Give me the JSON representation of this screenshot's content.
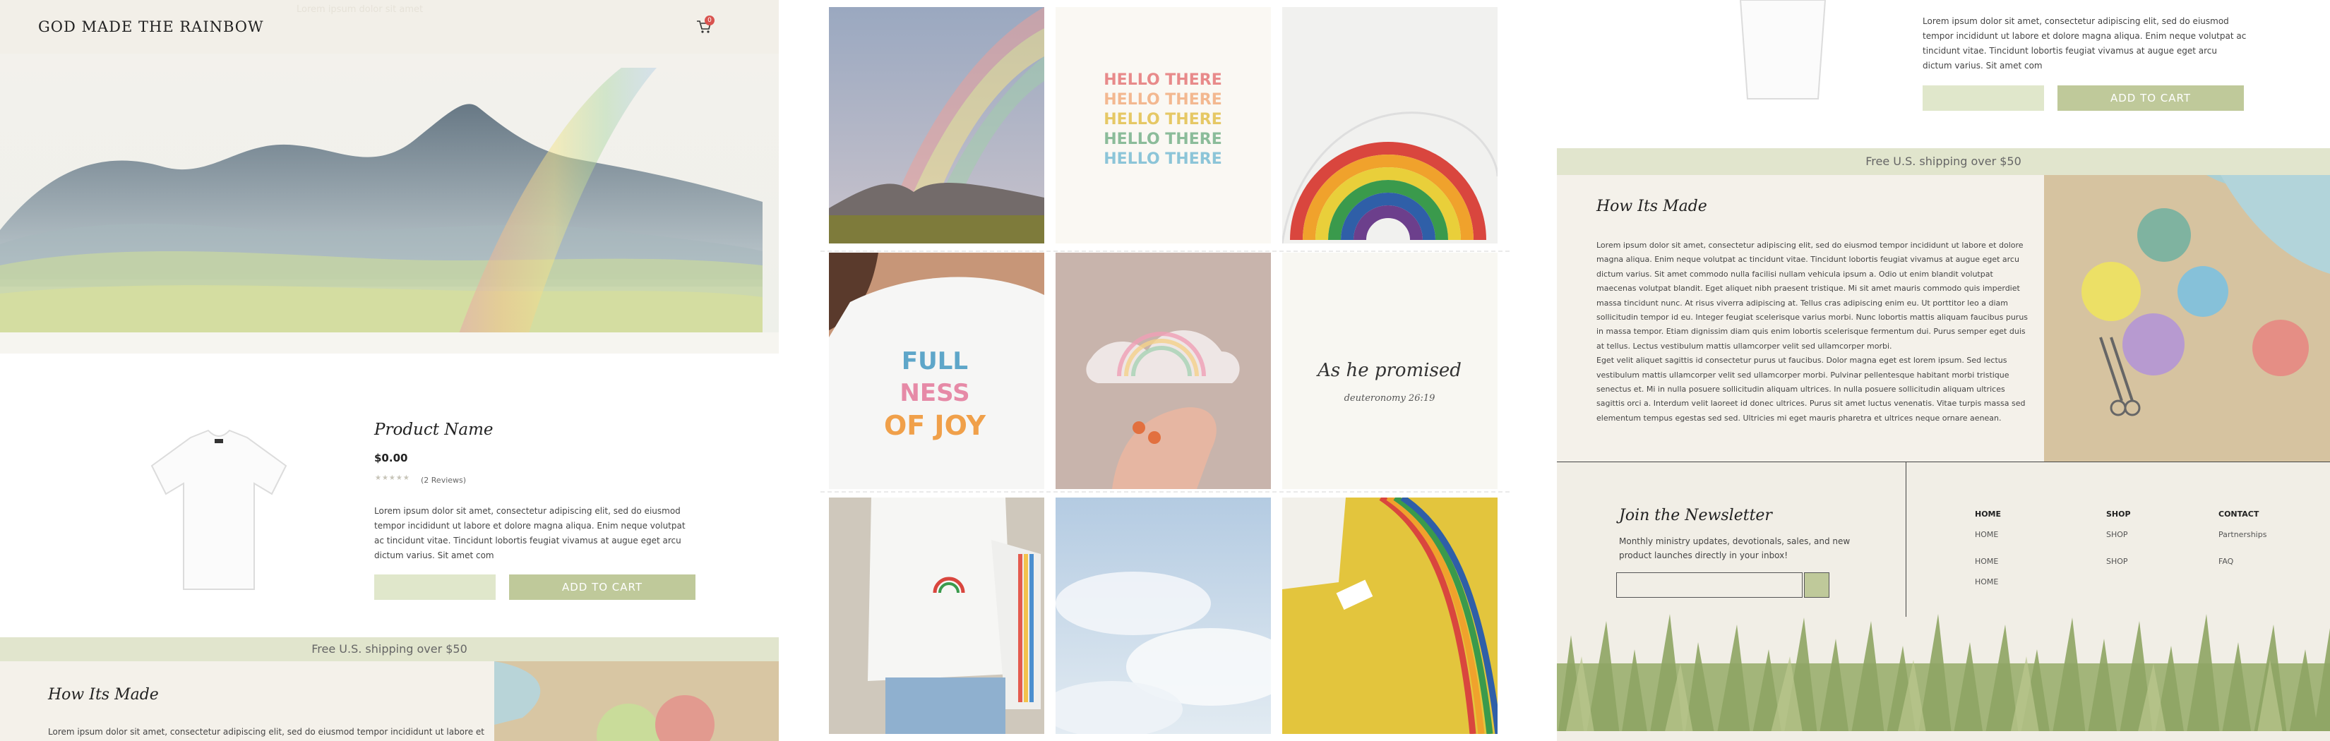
{
  "store": {
    "logo_text": "GOD MADE THE RAINBOW",
    "ghost_nav": "Lorem ipsum dolor sit amet",
    "cart_count": "0"
  },
  "product": {
    "name": "Product Name",
    "price": "$0.00",
    "stars": "★★★★★",
    "reviews": "(2 Reviews)",
    "description": "Lorem ipsum dolor sit amet, consectetur adipiscing elit, sed do eiusmod tempor incididunt ut labore et dolore magna aliqua. Enim neque volutpat ac tincidunt vitae. Tincidunt lobortis feugiat vivamus at augue eget arcu dictum varius. Sit amet com",
    "add_to_cart_label": "ADD TO CART"
  },
  "shipping_banner": "Free U.S. shipping over $50",
  "how_its_made": {
    "title": "How Its Made",
    "preview_text": "Lorem ipsum dolor sit amet, consectetur adipiscing elit, sed do eiusmod tempor incididunt ut labore et",
    "body": "Lorem ipsum dolor sit amet, consectetur adipiscing elit, sed do eiusmod tempor incididunt ut labore et dolore magna aliqua. Enim neque volutpat ac tincidunt vitae. Tincidunt lobortis feugiat vivamus at augue eget arcu dictum varius. Sit amet commodo nulla facilisi nullam vehicula ipsum a. Odio ut enim blandit volutpat maecenas volutpat blandit. Eget aliquet nibh praesent tristique. Mi sit amet mauris commodo quis imperdiet massa tincidunt nunc. At risus viverra adipiscing at. Tellus cras adipiscing enim eu. Ut porttitor leo a diam sollicitudin tempor id eu. Integer feugiat scelerisque varius morbi. Nunc lobortis mattis aliquam faucibus purus in massa tempor. Etiam dignissim diam quis enim lobortis scelerisque fermentum dui. Purus semper eget duis at tellus. Lectus vestibulum mattis ullamcorper velit sed ullamcorper morbi.",
    "body2": "Eget velit aliquet sagittis id consectetur purus ut faucibus. Dolor magna eget est lorem ipsum. Sed lectus vestibulum mattis ullamcorper velit sed ullamcorper morbi. Pulvinar pellentesque habitant morbi tristique senectus et. Mi in nulla posuere sollicitudin aliquam ultrices. In nulla posuere sollicitudin aliquam ultrices sagittis orci a. Interdum velit laoreet id donec ultrices. Purus sit amet luctus venenatis. Vitae turpis massa sed elementum tempus egestas sed sed. Ultricies mi eget mauris pharetra et ultrices neque ornare aenean."
  },
  "gallery": {
    "hello_text": "HELLO THERE",
    "fullness_text": "FULLNESS OF JOY",
    "promise_text": "As he promised",
    "promise_sub": "deuteronomy 26:19"
  },
  "newsletter": {
    "title": "Join the Newsletter",
    "text": "Monthly ministry updates, devotionals, sales, and new product launches directly in your inbox!",
    "input_value": ""
  },
  "footer": {
    "col1": {
      "heading": "HOME",
      "links": [
        "HOME",
        "HOME",
        "HOME"
      ]
    },
    "col2": {
      "heading": "SHOP",
      "links": [
        "SHOP",
        "SHOP"
      ]
    },
    "col3": {
      "heading": "CONTACT",
      "links": [
        "Partnerships",
        "FAQ"
      ]
    }
  },
  "colors": {
    "accent_green": "#bfc99a",
    "light_green": "#e0e7cb",
    "banner_green": "#e1e5cd",
    "cream": "#f4f1ea"
  }
}
